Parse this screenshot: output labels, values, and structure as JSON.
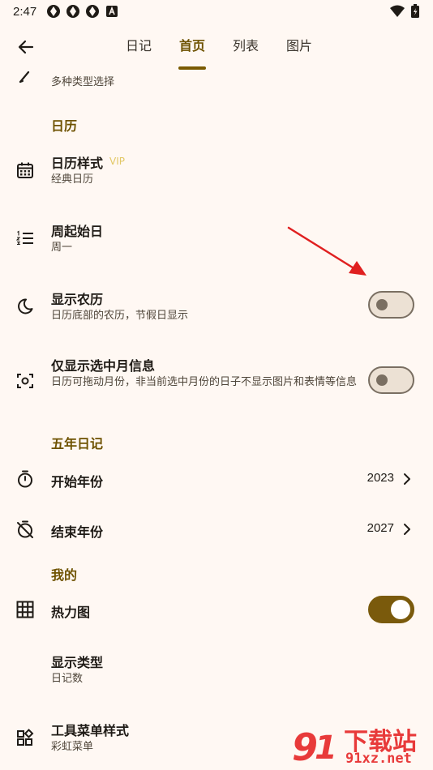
{
  "status_bar": {
    "time": "2:47"
  },
  "tabs": [
    {
      "label": "日记"
    },
    {
      "label": "首页",
      "active": true
    },
    {
      "label": "列表"
    },
    {
      "label": "图片"
    }
  ],
  "partial_item": {
    "subtitle": "多种类型选择"
  },
  "sections": {
    "calendar": "日历",
    "five_year": "五年日记",
    "mine": "我的"
  },
  "calendar_style": {
    "title": "日历样式",
    "badge": "VIP",
    "subtitle": "经典日历"
  },
  "week_start": {
    "title": "周起始日",
    "subtitle": "周一"
  },
  "show_lunar": {
    "title": "显示农历",
    "subtitle": "日历底部的农历，节假日显示",
    "enabled": false
  },
  "month_only": {
    "title": "仅显示选中月信息",
    "subtitle": "日历可拖动月份，非当前选中月份的日子不显示图片和表情等信息",
    "enabled": false
  },
  "start_year": {
    "title": "开始年份",
    "value": "2023"
  },
  "end_year": {
    "title": "结束年份",
    "value": "2027"
  },
  "heatmap": {
    "title": "热力图",
    "enabled": true
  },
  "display_type": {
    "title": "显示类型",
    "subtitle": "日记数"
  },
  "toolbar_style": {
    "title": "工具菜单样式",
    "subtitle": "彩虹菜单"
  },
  "colors": {
    "accent": "#7a5a00",
    "background": "#fff8f3",
    "annotation_arrow": "#e02020"
  },
  "watermark": {
    "text": "下载站",
    "sub": "91xz.net"
  }
}
